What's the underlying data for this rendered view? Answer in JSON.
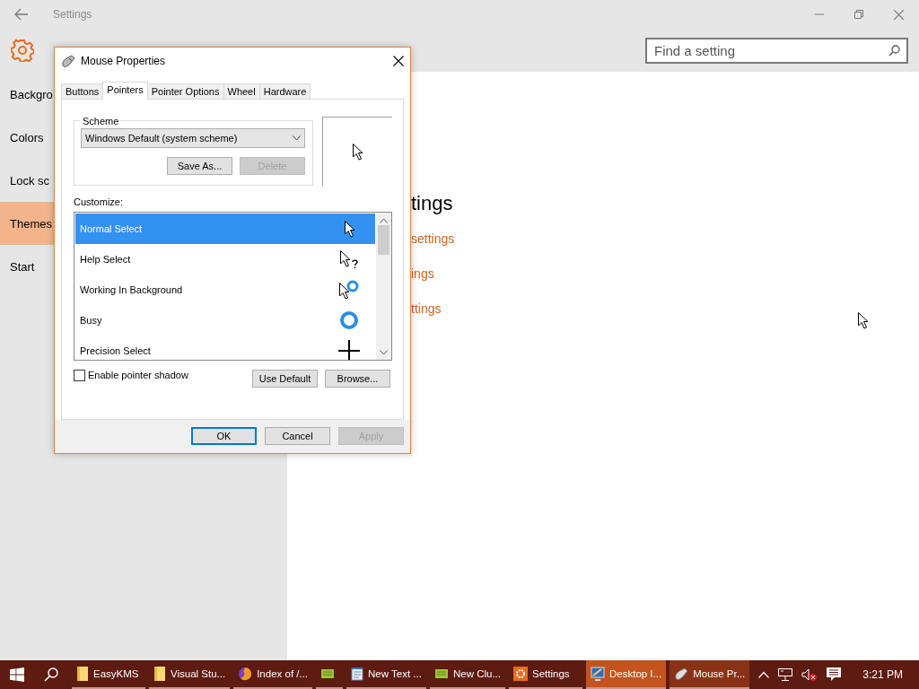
{
  "settings": {
    "title": "Settings",
    "search": {
      "placeholder": "Find a setting"
    },
    "nav": [
      {
        "label": "Backgro",
        "selected": false
      },
      {
        "label": "Colors",
        "selected": false
      },
      {
        "label": "Lock sc",
        "selected": false
      },
      {
        "label": "Themes",
        "selected": true
      },
      {
        "label": "Start",
        "selected": false
      }
    ],
    "heading": "tings",
    "links": [
      "settings",
      "ings",
      "ttings"
    ]
  },
  "dialog": {
    "title": "Mouse Properties",
    "tabs": [
      {
        "label": "Buttons",
        "selected": false
      },
      {
        "label": "Pointers",
        "selected": true
      },
      {
        "label": "Pointer Options",
        "selected": false
      },
      {
        "label": "Wheel",
        "selected": false
      },
      {
        "label": "Hardware",
        "selected": false
      }
    ],
    "scheme": {
      "label": "Scheme",
      "value": "Windows Default (system scheme)",
      "buttons": [
        {
          "label": "Save As...",
          "disabled": false
        },
        {
          "label": "Delete",
          "disabled": true
        }
      ]
    },
    "customize_label": "Customize:",
    "pointers": [
      {
        "name": "Normal Select",
        "kind": "arrow",
        "selected": true
      },
      {
        "name": "Help Select",
        "kind": "help",
        "selected": false
      },
      {
        "name": "Working In Background",
        "kind": "working",
        "selected": false
      },
      {
        "name": "Busy",
        "kind": "busy",
        "selected": false
      },
      {
        "name": "Precision Select",
        "kind": "cross",
        "selected": false
      }
    ],
    "shadow": {
      "label": "Enable pointer shadow",
      "checked": false
    },
    "list_buttons": [
      {
        "label": "Use Default",
        "disabled": false
      },
      {
        "label": "Browse...",
        "disabled": false
      }
    ],
    "footer_buttons": [
      {
        "label": "OK",
        "disabled": false,
        "default": true
      },
      {
        "label": "Cancel",
        "disabled": false,
        "default": false
      },
      {
        "label": "Apply",
        "disabled": true,
        "default": false
      }
    ]
  },
  "taskbar": {
    "apps": [
      {
        "label": "EasyKMS",
        "kind": "folder",
        "selected": false,
        "active": false
      },
      {
        "label": "Visual Stu...",
        "kind": "folder",
        "selected": false,
        "active": false
      },
      {
        "label": "Index of /...",
        "kind": "browser",
        "selected": false,
        "active": false
      },
      {
        "kind": "app",
        "selected": false,
        "active": false
      },
      {
        "label": "New Text ...",
        "kind": "notepad",
        "selected": false,
        "active": false
      },
      {
        "label": "New Clu...",
        "kind": "app",
        "selected": false,
        "active": false
      },
      {
        "label": "Settings",
        "kind": "gear",
        "selected": false,
        "active": false
      },
      {
        "label": "Desktop I...",
        "kind": "display",
        "selected": true,
        "active": false
      },
      {
        "label": "Mouse Pr...",
        "kind": "mouse",
        "selected": false,
        "active": true
      }
    ],
    "clock": "3:21 PM"
  }
}
